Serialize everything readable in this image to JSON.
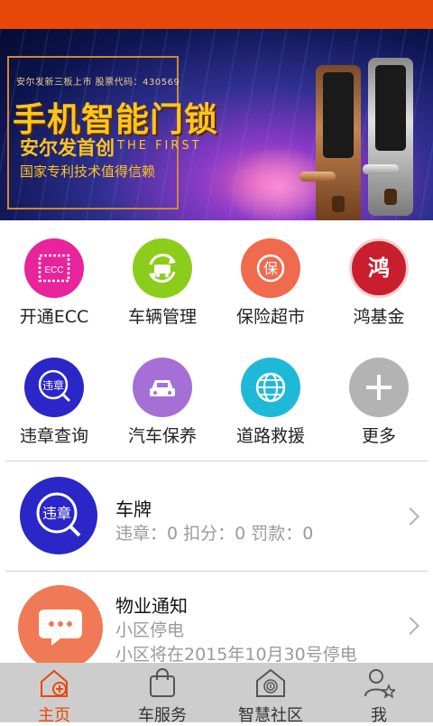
{
  "banner": {
    "stock_line": "安尔发新三板上市 股票代码：430569",
    "title": "手机智能门锁",
    "subtitle": "安尔发首创",
    "subtitle_en": "THE FIRST",
    "tagline": "国家专利技术值得信赖"
  },
  "menu": [
    {
      "label": "开通ECC",
      "icon": "ecc-stamp-icon",
      "color": "#e8239b",
      "glyph": "ECC"
    },
    {
      "label": "车辆管理",
      "icon": "car-refresh-icon",
      "color": "#8ccc1a",
      "glyph": ""
    },
    {
      "label": "保险超市",
      "icon": "insurance-icon",
      "color": "#f06a4d",
      "glyph": "保"
    },
    {
      "label": "鸿基金",
      "icon": "hong-fund-logo",
      "color": "#c81e2e",
      "glyph": "鸿"
    },
    {
      "label": "违章查询",
      "icon": "violation-search-icon",
      "color": "#2a26c8",
      "glyph": "违章"
    },
    {
      "label": "汽车保养",
      "icon": "car-maintenance-icon",
      "color": "#a56fd6",
      "glyph": ""
    },
    {
      "label": "道路救援",
      "icon": "globe-icon",
      "color": "#1fb9d8",
      "glyph": ""
    },
    {
      "label": "更多",
      "icon": "plus-icon",
      "color": "#b3b3b3",
      "glyph": "+"
    }
  ],
  "rows": [
    {
      "name": "车牌",
      "detail1": "违章：0 扣分：0 罚款：0",
      "detail2": "",
      "icon": "violation-search-icon",
      "avatar_glyph": "违章",
      "color": "#2a26c8"
    },
    {
      "name": "物业通知",
      "detail1": "小区停电",
      "detail2": "小区将在2015年10月30号停电",
      "icon": "message-icon",
      "avatar_glyph": "…",
      "color": "#f07a55"
    }
  ],
  "tabs": [
    {
      "label": "主页",
      "icon": "home-add-icon",
      "active": true
    },
    {
      "label": "车服务",
      "icon": "shopping-bag-icon",
      "active": false
    },
    {
      "label": "智慧社区",
      "icon": "fingerprint-house-icon",
      "active": false
    },
    {
      "label": "我",
      "icon": "user-star-icon",
      "active": false
    }
  ],
  "colors": {
    "accent": "#e8480a",
    "tabbar": "#cdcdcd"
  }
}
